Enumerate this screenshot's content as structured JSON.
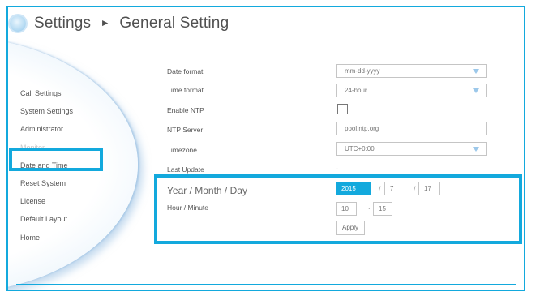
{
  "header": {
    "title": "Settings",
    "separator": "►",
    "subtitle": "General Setting"
  },
  "sidebar": {
    "items": [
      {
        "label": "Call Settings"
      },
      {
        "label": "System Settings"
      },
      {
        "label": "Administrator"
      },
      {
        "label": "Monitor"
      },
      {
        "label": "Date and Time"
      },
      {
        "label": "Reset System"
      },
      {
        "label": "License"
      },
      {
        "label": "Default Layout"
      },
      {
        "label": "Home"
      }
    ]
  },
  "form": {
    "date_format_label": "Date format",
    "date_format_value": "mm-dd-yyyy",
    "time_format_label": "Time format",
    "time_format_value": "24-hour",
    "enable_ntp_label": "Enable NTP",
    "ntp_server_label": "NTP Server",
    "ntp_server_value": "pool.ntp.org",
    "timezone_label": "Timezone",
    "timezone_value": "UTC+0:00",
    "last_update_label": "Last Update",
    "last_update_value": "-",
    "ymd_label": "Year / Month / Day",
    "year": "2015",
    "month": "7",
    "day": "17",
    "date_separator": "/",
    "hm_label": "Hour / Minute",
    "hour": "10",
    "minute": "15",
    "time_separator": ":",
    "apply_label": "Apply"
  },
  "colors": {
    "accent": "#13a9dd"
  }
}
